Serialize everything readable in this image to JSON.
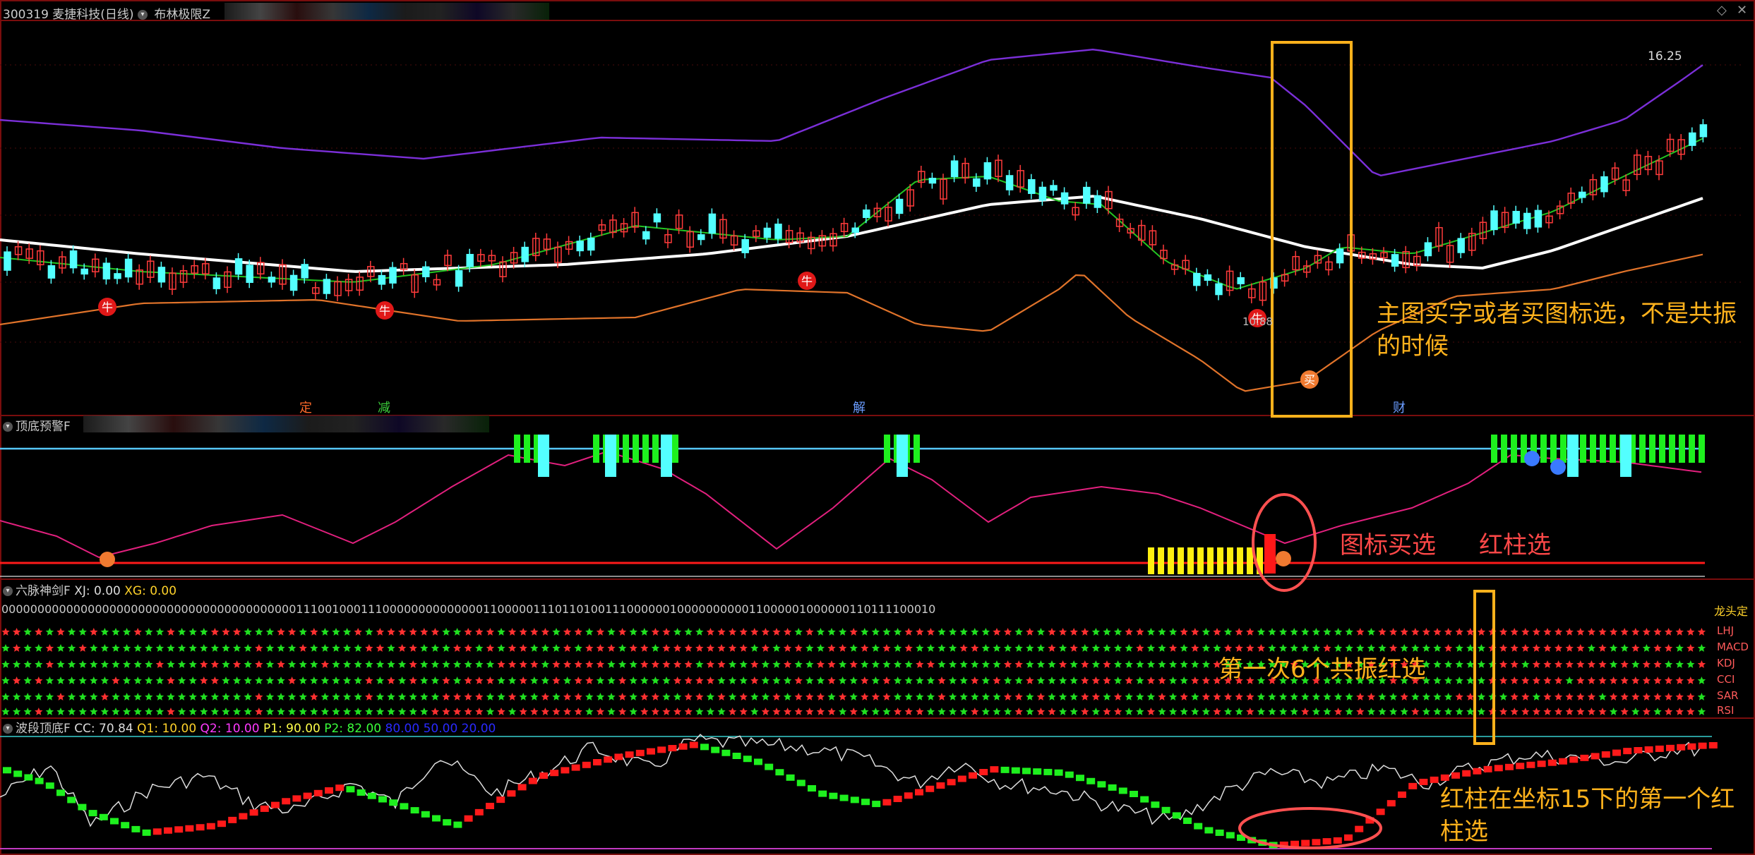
{
  "header": {
    "code_title": "300319 麦捷科技(日线)",
    "indicator_name": "布林极限Z",
    "top_right_icon": "diamond-icon",
    "close_icon": "close-icon"
  },
  "main_chart": {
    "price_label": "16.25",
    "low_label": "10.88",
    "signal_text": "牛",
    "buy_text": "买",
    "events": [
      "定",
      "减",
      "解",
      "财"
    ],
    "colors": {
      "up_candle": "#ff3b3b",
      "down_candle": "#53ffff",
      "bb_upper": "#7b2fd8",
      "bb_lower": "#e0732a",
      "ma_mid": "#ffffff",
      "ma_short": "#22c522"
    }
  },
  "panel_top_bottom": {
    "title": "顶底预警F",
    "buy_text": "买"
  },
  "panel_six": {
    "title": "六脉神剑F",
    "xj_label": "XJ: 0.00",
    "xg_label": "XG: 0.00",
    "top_right_label": "龙头定",
    "row_labels": [
      "LHJ",
      "MACD",
      "KDJ",
      "CCI",
      "SAR",
      "RSI"
    ],
    "digit_row": "0000000000000000000000000000000000000000011100100011100000000000000110000011101101001110000001000000000011000001000000110111100010",
    "colors": {
      "green": "#20e020",
      "red": "#ff3030"
    }
  },
  "panel_wave": {
    "title": "波段顶底F",
    "cc": "CC: 70.84",
    "q1": "Q1: 10.00",
    "q2": "Q2: 10.00",
    "p1": "P1: 90.00",
    "p2": "P2: 82.00",
    "v80": "80.00",
    "v50": "50.00",
    "v20": "20.00"
  },
  "annotations": {
    "main_note": "主图买字或者买图标选，不是共振的时候",
    "icon_buy": "图标买选",
    "red_bar": "红柱选",
    "resonance": "第一次6个共振红选",
    "coord_note": "红柱在坐标15下的第一个红柱选"
  }
}
